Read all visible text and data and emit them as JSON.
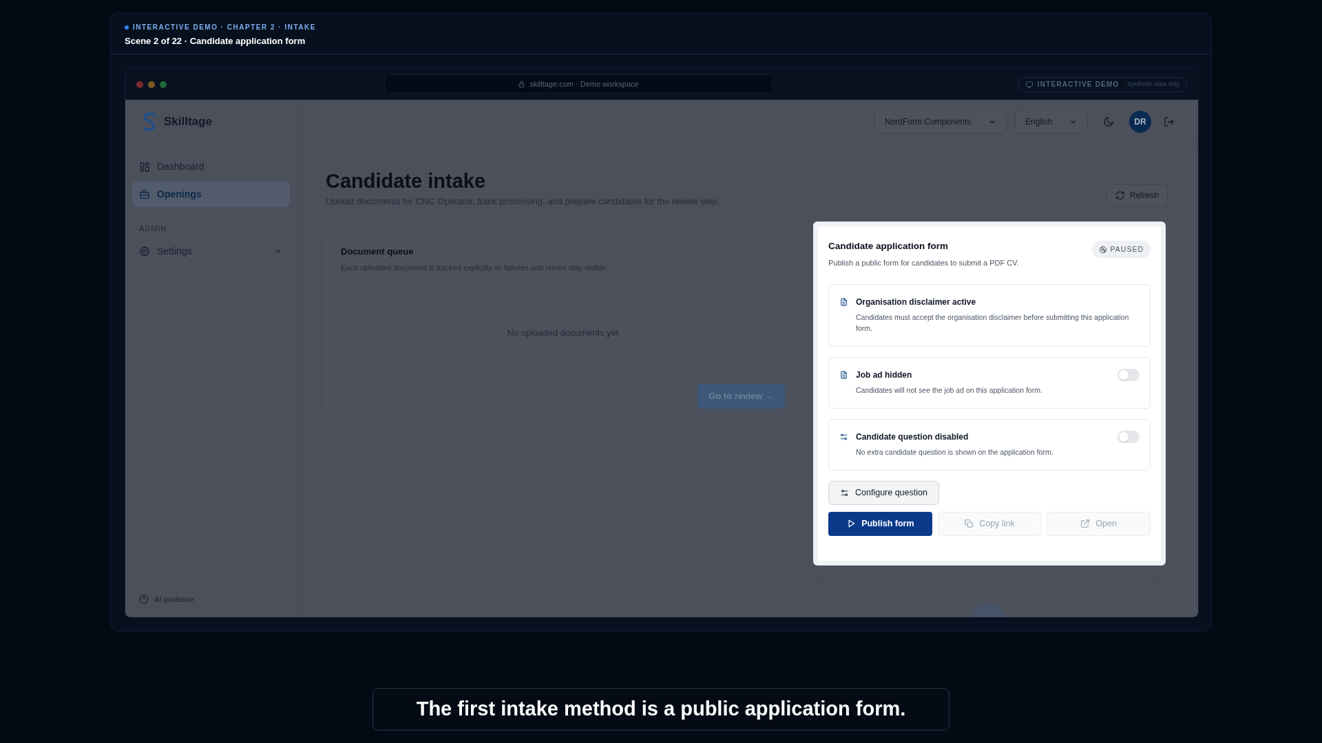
{
  "banner": {
    "eyebrow": "INTERACTIVE DEMO · CHAPTER 2 · INTAKE",
    "title": "Scene 2 of 22 · Candidate application form"
  },
  "browser": {
    "address": "skilltage.com · Demo workspace",
    "badge": "INTERACTIVE DEMO",
    "badge_note": "· Synthetic data only"
  },
  "app_header": {
    "brand": "Skilltage",
    "workspace": "NordForm Components",
    "language": "English",
    "avatar": "DR"
  },
  "sidebar": {
    "items": [
      {
        "label": "Dashboard",
        "selected": false
      },
      {
        "label": "Openings",
        "selected": true
      }
    ],
    "section": "ADMIN",
    "admin_items": [
      {
        "label": "Settings",
        "expanded": false
      }
    ],
    "footer": "AI guidance"
  },
  "page": {
    "title": "Candidate intake",
    "subtitle": "Upload documents for CNC Operator, track processing, and prepare candidates for the review step.",
    "refresh": "Refresh"
  },
  "document_queue": {
    "title": "Document queue",
    "description": "Each uploaded document is tracked explicitly so failures and retries stay visible.",
    "empty": "No uploaded documents yet",
    "action": "Go to review →",
    "disabled": true
  },
  "form_panel": {
    "title": "Candidate application form",
    "description": "Publish a public form for candidates to submit a PDF CV.",
    "status": "PAUSED",
    "settings": [
      {
        "kind": "info",
        "title": "Organisation disclaimer active",
        "description": "Candidates must accept the organisation disclaimer before submitting this application form."
      },
      {
        "kind": "toggle",
        "title": "Job ad hidden",
        "description": "Candidates will not see the job ad on this application form.",
        "on": false
      },
      {
        "kind": "toggle",
        "title": "Candidate question disabled",
        "description": "No extra candidate question is shown on the application form.",
        "on": false
      }
    ],
    "configure": "Configure question",
    "actions": [
      {
        "kind": "primary",
        "label": "Publish form"
      },
      {
        "kind": "secondary",
        "label": "Copy link"
      },
      {
        "kind": "secondary",
        "label": "Open"
      }
    ]
  },
  "caption": "The first intake method is a public application form."
}
